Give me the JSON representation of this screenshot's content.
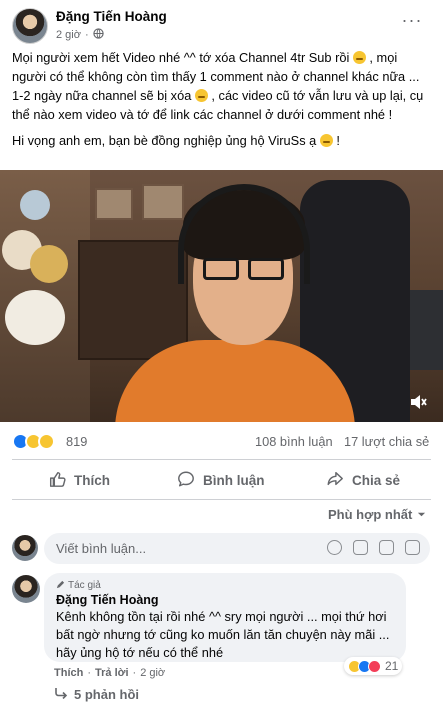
{
  "post": {
    "author": "Đặng Tiến Hoàng",
    "time": "2 giờ",
    "more_label": "···",
    "paragraph1_a": "Mọi người xem hết Video nhé ^^ tớ xóa Channel 4tr Sub rồi ",
    "paragraph1_b": " , mọi người có thể không còn tìm thấy 1 comment nào ở channel khác nữa ... 1-2 ngày nữa channel sẽ bị xóa ",
    "paragraph1_c": " , các video cũ tớ vẫn lưu và up lại, cụ thể nào xem video và tớ để link các channel ở dưới comment nhé !",
    "paragraph2_a": "Hi vọng anh em, bạn bè đồng nghiệp ủng hộ ViruSs ạ ",
    "paragraph2_b": " !"
  },
  "stats": {
    "reactions": "819",
    "comments": "108 bình luận",
    "shares": "17 lượt chia sẻ"
  },
  "actions": {
    "like": "Thích",
    "comment": "Bình luận",
    "share": "Chia sẻ"
  },
  "sort": {
    "label": "Phù hợp nhất"
  },
  "comment_input": {
    "placeholder": "Viết bình luận..."
  },
  "comment": {
    "badge": "Tác giả",
    "name": "Đặng Tiến Hoàng",
    "text": "Kênh không tồn tại rồi nhé ^^ sry mọi người ... mọi thứ hơi bất ngờ nhưng tớ cũng ko muốn lăn tăn chuyện này mãi ... hãy ủng hộ tớ nếu có thể nhé",
    "like": "Thích",
    "reply": "Trả lời",
    "time": "2 giờ",
    "reaction_count": "21",
    "replies": "5 phản hồi"
  },
  "colors": {
    "like_blue": "#1877f2",
    "secondary_text": "#65676b",
    "bubble_bg": "#f0f2f5",
    "shirt_orange": "#e17b2c"
  }
}
